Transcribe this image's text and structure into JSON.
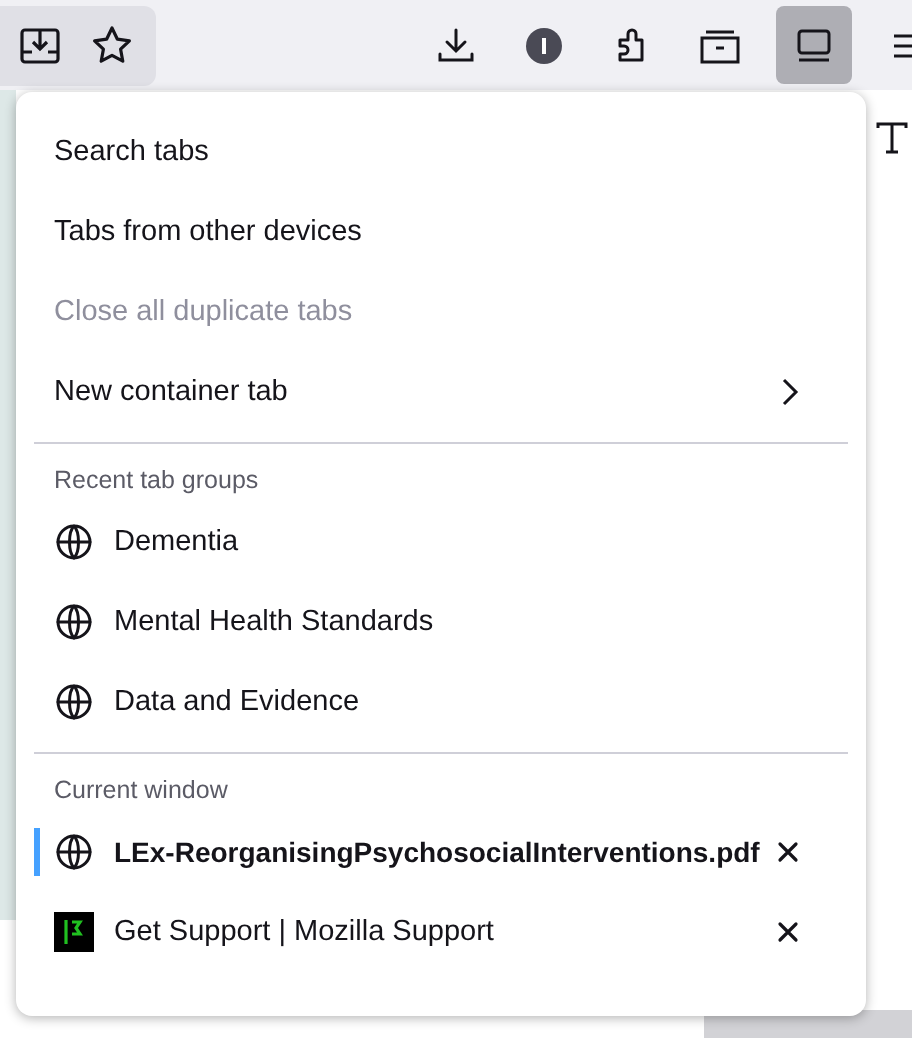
{
  "menu": {
    "actions": [
      {
        "label": "Search tabs",
        "disabled": false,
        "submenu": false
      },
      {
        "label": "Tabs from other devices",
        "disabled": false,
        "submenu": false
      },
      {
        "label": "Close all duplicate tabs",
        "disabled": true,
        "submenu": false
      },
      {
        "label": "New container tab",
        "disabled": false,
        "submenu": true
      }
    ],
    "recent_groups": {
      "header": "Recent tab groups",
      "items": [
        {
          "label": "Dementia"
        },
        {
          "label": "Mental Health Standards"
        },
        {
          "label": "Data and Evidence"
        }
      ]
    },
    "current_window": {
      "header": "Current window",
      "tabs": [
        {
          "label": "LEx-ReorganisingPsychosocialInterventions.pdf",
          "selected": true,
          "kind": "globe"
        },
        {
          "label": "Get Support | Mozilla Support",
          "selected": false,
          "kind": "support"
        }
      ]
    }
  }
}
